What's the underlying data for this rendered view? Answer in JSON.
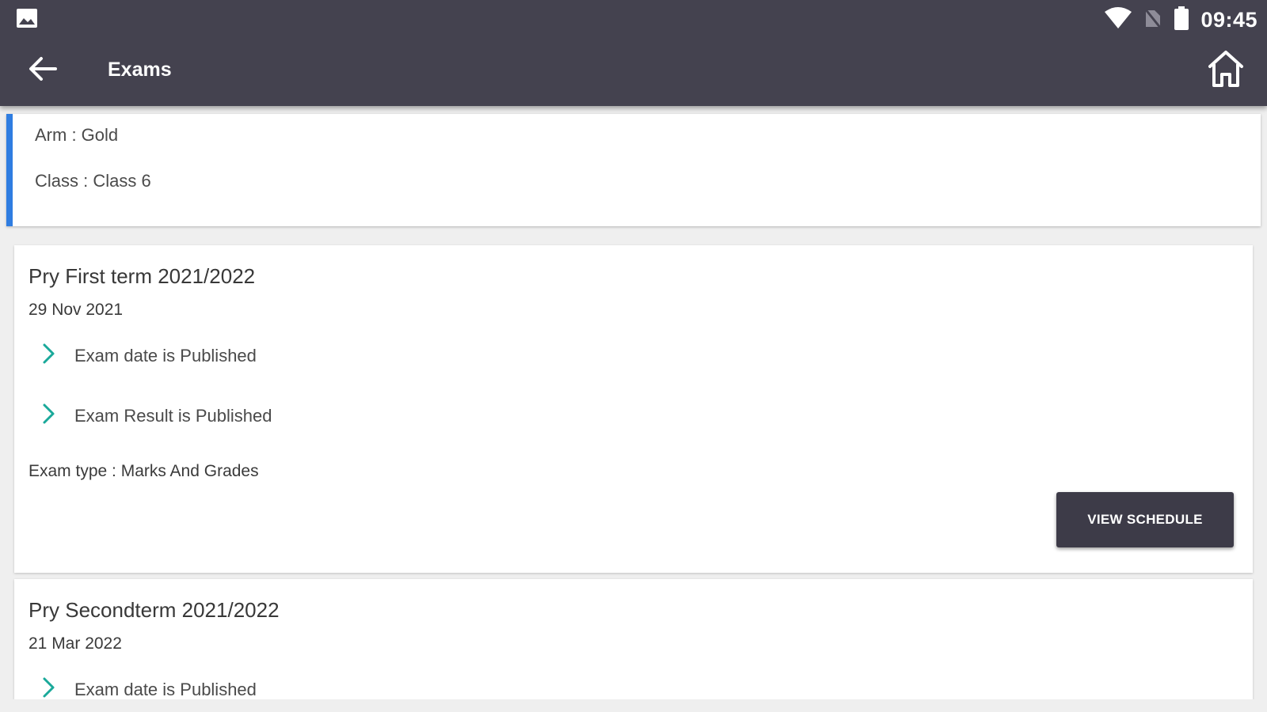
{
  "status_bar": {
    "time": "09:45",
    "icons": [
      "image-notification-icon",
      "wifi-icon",
      "no-sim-icon",
      "battery-icon"
    ]
  },
  "app_bar": {
    "title": "Exams",
    "back_icon": "arrow-left-icon",
    "home_icon": "home-icon"
  },
  "info": {
    "arm": "Arm : Gold",
    "class": "Class : Class 6"
  },
  "exams": [
    {
      "title": "Pry First term 2021/2022",
      "date": "29 Nov 2021",
      "statuses": [
        "Exam date is Published",
        "Exam Result is Published"
      ],
      "exam_type": "Exam type : Marks And Grades",
      "button_label": "VIEW SCHEDULE"
    },
    {
      "title": "Pry Secondterm 2021/2022",
      "date": "21 Mar 2022",
      "statuses": [
        "Exam date is Published"
      ]
    }
  ],
  "colors": {
    "header": "#44424f",
    "accent_bar": "#2f7de1",
    "chevron": "#1aa99a",
    "button": "#3d3b48",
    "background": "#efefef"
  }
}
